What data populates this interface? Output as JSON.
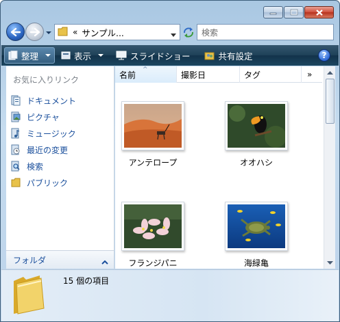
{
  "window": {
    "controls": [
      "minimize",
      "maximize",
      "close"
    ]
  },
  "nav": {
    "breadcrumb_chevron": "«",
    "address_path": "サンプル...",
    "search_placeholder": "検索"
  },
  "toolbar": {
    "organize": "整理",
    "views": "表示",
    "slideshow": "スライドショー",
    "share": "共有設定",
    "help": "?"
  },
  "sidebar": {
    "favorites_heading": "お気に入りリンク",
    "items": [
      {
        "label": "ドキュメント",
        "icon": "documents-icon"
      },
      {
        "label": "ピクチャ",
        "icon": "pictures-icon"
      },
      {
        "label": "ミュージック",
        "icon": "music-icon"
      },
      {
        "label": "最近の変更",
        "icon": "recent-changes-icon"
      },
      {
        "label": "検索",
        "icon": "searches-icon"
      },
      {
        "label": "パブリック",
        "icon": "public-folder-icon"
      }
    ],
    "folders_label": "フォルダ"
  },
  "columns": [
    "名前",
    "撮影日",
    "タグ",
    "»"
  ],
  "sort": {
    "column": "名前",
    "indicator": "^"
  },
  "files": [
    {
      "name": "アンテロープ"
    },
    {
      "name": "オオハシ"
    },
    {
      "name": "フランジパニ"
    },
    {
      "name": "海緑亀"
    }
  ],
  "details": {
    "item_count_text": "15 個の項目"
  },
  "colors": {
    "link": "#1a4f9c",
    "toolbar_dark": "#1f4259"
  }
}
